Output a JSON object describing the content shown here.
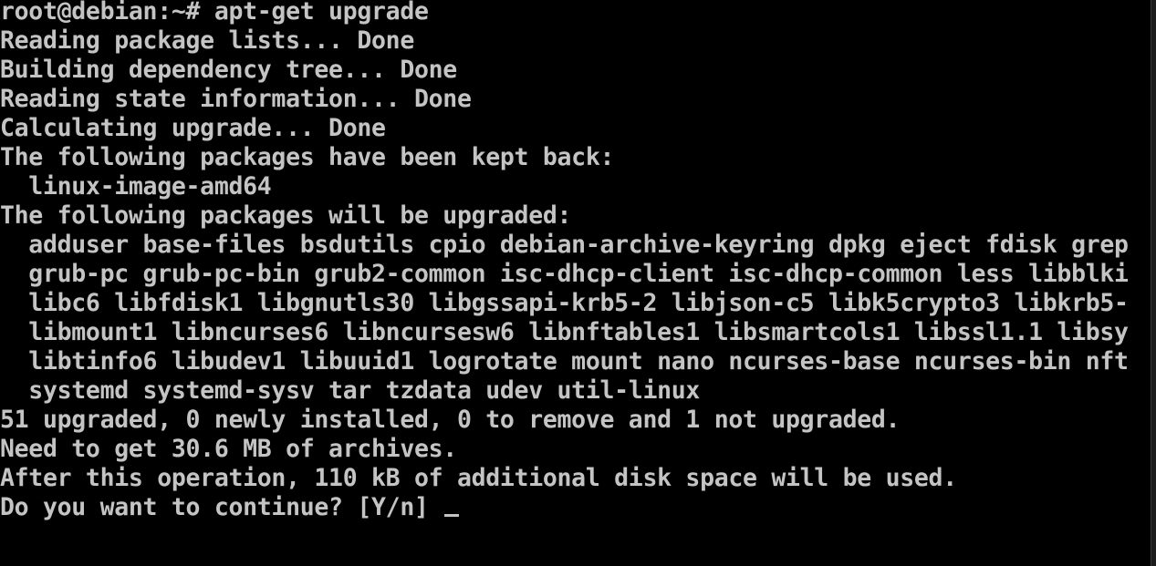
{
  "terminal": {
    "colors": {
      "background": "#000000",
      "foreground": "#c4c4c4"
    },
    "lines": [
      "root@debian:~# apt-get upgrade",
      "Reading package lists... Done",
      "Building dependency tree... Done",
      "Reading state information... Done",
      "Calculating upgrade... Done",
      "The following packages have been kept back:",
      "  linux-image-amd64",
      "The following packages will be upgraded:",
      "  adduser base-files bsdutils cpio debian-archive-keyring dpkg eject fdisk grep",
      "  grub-pc grub-pc-bin grub2-common isc-dhcp-client isc-dhcp-common less libblki",
      "  libc6 libfdisk1 libgnutls30 libgssapi-krb5-2 libjson-c5 libk5crypto3 libkrb5-",
      "  libmount1 libncurses6 libncursesw6 libnftables1 libsmartcols1 libssl1.1 libsy",
      "  libtinfo6 libudev1 libuuid1 logrotate mount nano ncurses-base ncurses-bin nft",
      "  systemd systemd-sysv tar tzdata udev util-linux",
      "51 upgraded, 0 newly installed, 0 to remove and 1 not upgraded.",
      "Need to get 30.6 MB of archives.",
      "After this operation, 110 kB of additional disk space will be used."
    ],
    "prompt": "Do you want to continue? [Y/n] "
  }
}
